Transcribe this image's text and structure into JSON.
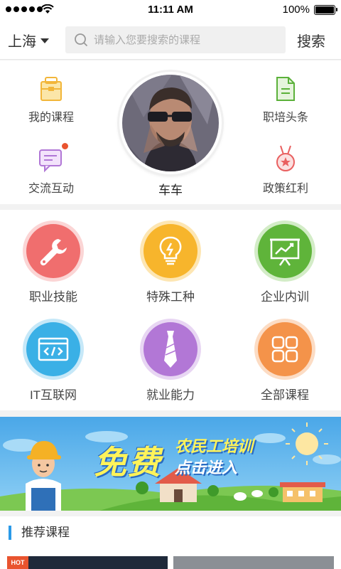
{
  "status_bar": {
    "time": "11:11 AM",
    "battery": "100%"
  },
  "header": {
    "city": "上海",
    "search_placeholder": "请输入您要搜索的课程",
    "search_button": "搜索"
  },
  "profile": {
    "username": "车车",
    "left_items": [
      {
        "label": "我的课程",
        "icon": "briefcase-icon"
      },
      {
        "label": "交流互动",
        "icon": "chat-icon"
      }
    ],
    "right_items": [
      {
        "label": "职培头条",
        "icon": "document-icon"
      },
      {
        "label": "政策红利",
        "icon": "medal-icon"
      }
    ]
  },
  "categories": [
    {
      "label": "职业技能",
      "icon": "wrench-icon",
      "color": "#f06e6e"
    },
    {
      "label": "特殊工种",
      "icon": "lightbulb-icon",
      "color": "#f7b52c"
    },
    {
      "label": "企业内训",
      "icon": "presentation-icon",
      "color": "#5fb43a"
    },
    {
      "label": "IT互联网",
      "icon": "code-window-icon",
      "color": "#3ab0e6"
    },
    {
      "label": "就业能力",
      "icon": "tie-icon",
      "color": "#b277d6"
    },
    {
      "label": "全部课程",
      "icon": "grid-icon",
      "color": "#f4934a"
    }
  ],
  "banner": {
    "big_text": "免费",
    "line1": "农民工培训",
    "line2": "点击进入"
  },
  "recommend": {
    "title": "推荐课程",
    "hot_badge": "HOT"
  },
  "colors": {
    "accent": "#2a9ae8",
    "notify": "#e9542f"
  }
}
